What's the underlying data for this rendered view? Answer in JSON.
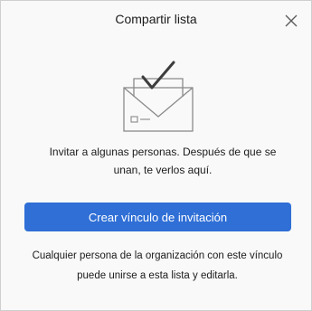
{
  "dialog": {
    "title": "Compartir lista",
    "close_icon": "close-icon",
    "illustration_icon": "envelope-checkmark-icon",
    "message": "Invitar a algunas personas. Después de que se unan, te verlos aquí.",
    "primary_button_label": "Crear vínculo de invitación",
    "footer_note": "Cualquier persona de la organización con este vínculo puede unirse a esta lista y editarla.",
    "colors": {
      "accent": "#2f6fd6",
      "background": "#f9f9f9",
      "text": "#1b1b1b"
    }
  }
}
